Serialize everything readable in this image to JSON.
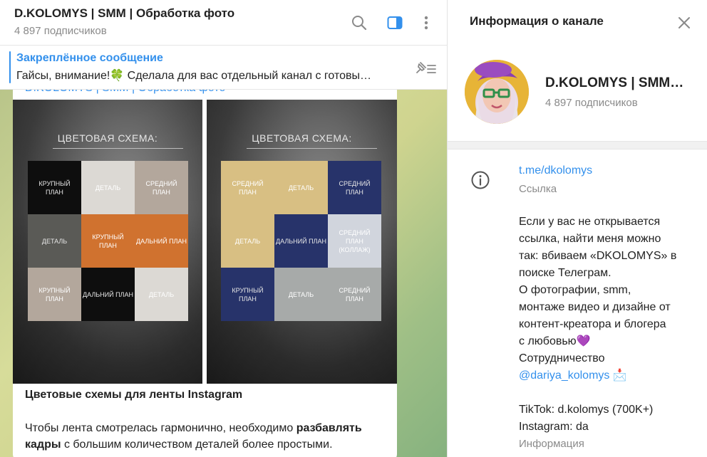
{
  "header": {
    "title": "D.KOLOMYS | SMM | Обработка фото",
    "subscribers": "4 897 подписчиков"
  },
  "pinned": {
    "title": "Закреплённое сообщение",
    "text": "Гайсы, внимание!🍀  Сделала для вас отдельный канал с готовы…"
  },
  "message": {
    "author": "D.KOLOMYS | SMM | Обработка фото",
    "photos": [
      {
        "title": "ЦВЕТОВАЯ СХЕМА:",
        "cells": [
          {
            "label": "КРУПНЫЙ ПЛАН",
            "color": "#0e0e0e",
            "text_color": "#e6e6e6"
          },
          {
            "label": "ДЕТАЛЬ",
            "color": "#dcd9d4",
            "text_color": "#ffffff"
          },
          {
            "label": "СРЕДНИЙ ПЛАН",
            "color": "#b3a79c",
            "text_color": "#ffffff"
          },
          {
            "label": "ДЕТАЛЬ",
            "color": "#5a5a56",
            "text_color": "#e6e6e6"
          },
          {
            "label": "КРУПНЫЙ ПЛАН",
            "color": "#d0722f",
            "text_color": "#ffffff"
          },
          {
            "label": "ДАЛЬНИЙ ПЛАН",
            "color": "#d0722f",
            "text_color": "#ffffff"
          },
          {
            "label": "КРУПНЫЙ ПЛАН",
            "color": "#b3a79c",
            "text_color": "#ffffff"
          },
          {
            "label": "ДАЛЬНИЙ ПЛАН",
            "color": "#0e0e0e",
            "text_color": "#e6e6e6"
          },
          {
            "label": "ДЕТАЛЬ",
            "color": "#dcd9d4",
            "text_color": "#ffffff"
          }
        ]
      },
      {
        "title": "ЦВЕТОВАЯ СХЕМА:",
        "cells": [
          {
            "label": "СРЕДНИЙ ПЛАН",
            "color": "#d8bf83",
            "text_color": "#ffffff"
          },
          {
            "label": "ДЕТАЛЬ",
            "color": "#d8bf83",
            "text_color": "#ffffff"
          },
          {
            "label": "СРЕДНИЙ ПЛАН",
            "color": "#27336a",
            "text_color": "#e6e6e6"
          },
          {
            "label": "ДЕТАЛЬ",
            "color": "#d8bf83",
            "text_color": "#ffffff"
          },
          {
            "label": "ДАЛЬНИЙ ПЛАН",
            "color": "#27336a",
            "text_color": "#e6e6e6"
          },
          {
            "label": "СРЕДНИЙ ПЛАН (КОЛЛАЖ)",
            "color": "#d1d5dd",
            "text_color": "#ffffff"
          },
          {
            "label": "КРУПНЫЙ ПЛАН",
            "color": "#27336a",
            "text_color": "#e6e6e6"
          },
          {
            "label": "ДЕТАЛЬ",
            "color": "#a7aaa9",
            "text_color": "#ffffff"
          },
          {
            "label": "СРЕДНИЙ ПЛАН",
            "color": "#a7aaa9",
            "text_color": "#ffffff"
          }
        ]
      }
    ],
    "caption_title": "Цветовые схемы для ленты Instagram",
    "caption_part1": "Чтобы лента смотрелась гармонично, необходимо ",
    "caption_bold": "разбавлять кадры",
    "caption_part2": " с большим количеством деталей более простыми."
  },
  "info": {
    "heading": "Информация о канале",
    "name": "D.KOLOMYS | SMM…",
    "subscribers": "4 897 подписчиков",
    "link": "t.me/dkolomys",
    "link_label": "Ссылка",
    "desc_lines": [
      "Если у вас не открывается",
      "ссылка, найти меня можно",
      "так: вбиваем «DKOLOMYS» в",
      "поиске Телеграм.",
      "О фотографии, smm,",
      "монтаже видео и дизайне от",
      "контент-креатора и блогера",
      "с любовью💜",
      "Сотрудничество",
      "",
      "",
      "TikTok: d.kolomys (700K+)",
      "Instagram: da"
    ],
    "mention": "@dariya_kolomys",
    "mention_emoji": "📩",
    "desc_label": "Информация"
  },
  "icons": {
    "search": "search-icon",
    "sidebar": "sidebar-toggle-icon",
    "more": "more-vertical-icon",
    "unpin": "pin-list-icon",
    "close": "close-icon",
    "info": "info-icon"
  },
  "colors": {
    "accent": "#3390ec",
    "secondary_text": "#8a8a8a"
  }
}
